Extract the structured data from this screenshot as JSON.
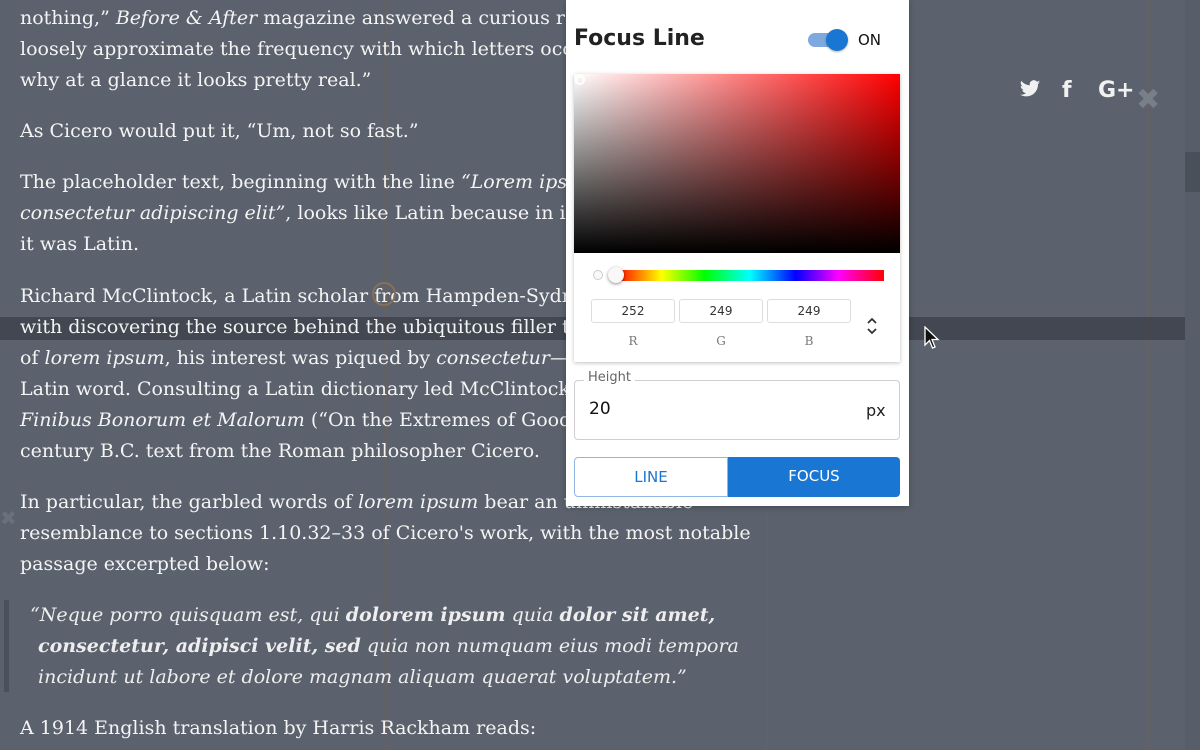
{
  "article": {
    "lines": [
      [
        {
          "t": "nothing,” "
        },
        {
          "t": "Before & After",
          "em": true
        },
        {
          "t": " magazine answered a curious reade"
        }
      ],
      [
        {
          "t": "loosely approximate the frequency with which letters occur i"
        }
      ],
      [
        {
          "t": "why at a glance it looks pretty real.”"
        }
      ],
      [
        {
          "t": "As Cicero would put it, “Um, not so fast.”"
        }
      ],
      [
        {
          "t": "The placeholder text, beginning with the line "
        },
        {
          "t": "“Lorem ipsum",
          "em": true
        }
      ],
      [
        {
          "t": "consectetur adipiscing elit”",
          "em": true
        },
        {
          "t": ", looks like Latin because in its yo"
        }
      ],
      [
        {
          "t": "it was Latin."
        }
      ],
      [
        {
          "t": "Richard McClintock, a Latin scholar from Hampden-Sydney"
        }
      ],
      [
        {
          "t": "with discovering the source behind the ubiquitous filler text."
        }
      ],
      [
        {
          "t": "of "
        },
        {
          "t": "lorem ipsum",
          "em": true
        },
        {
          "t": ", his interest was piqued by "
        },
        {
          "t": "consectetur",
          "em": true
        },
        {
          "t": "—a ge"
        }
      ],
      [
        {
          "t": "Latin word. Consulting a Latin dictionary led McClintock to"
        }
      ],
      [
        {
          "t": "Finibus Bonorum et Malorum",
          "em": true
        },
        {
          "t": " (“On the Extremes of Good an"
        }
      ],
      [
        {
          "t": "century B.C. text from the Roman philosopher Cicero."
        }
      ],
      [
        {
          "t": "In particular, the garbled words of "
        },
        {
          "t": "lorem ipsum",
          "em": true
        },
        {
          "t": " bear an unmistakable"
        }
      ],
      [
        {
          "t": "resemblance to sections 1.10.32–33 of Cicero's work, with the most notable"
        }
      ],
      [
        {
          "t": "passage excerpted below:"
        }
      ],
      [
        {
          "t": "“Neque porro quisquam est, qui ",
          "em": true
        },
        {
          "t": "dolorem ipsum",
          "b": true
        },
        {
          "t": " quia ",
          "em": true
        },
        {
          "t": "dolor sit amet,",
          "b": true
        }
      ],
      [
        {
          "t": "consectetur, adipisci velit, sed",
          "b": true
        },
        {
          "t": " quia non numquam eius modi tempora",
          "em": true
        }
      ],
      [
        {
          "t": "incidunt ut labore et dolore magnam aliquam quaerat voluptatem.”",
          "em": true
        }
      ],
      [
        {
          "t": "A 1914 English translation by Harris Rackham reads:"
        }
      ]
    ]
  },
  "social": {
    "twitter": "🐦",
    "facebook": "f",
    "google": "G+"
  },
  "icons": {
    "close": "✖",
    "left_close": "✖",
    "cursor": "mouse-pointer-icon"
  },
  "panel": {
    "title": "Focus Line",
    "toggle_label": "ON",
    "toggle_on": true,
    "color": {
      "r": "252",
      "g": "249",
      "b": "249",
      "hue_position": 0.01
    },
    "rgb_labels": {
      "r": "R",
      "g": "G",
      "b": "B"
    },
    "arrows": "⌃\n⌄",
    "height": {
      "label": "Height",
      "value": "20",
      "unit": "px"
    },
    "modes": {
      "line": "LINE",
      "focus": "FOCUS",
      "selected": "focus"
    }
  },
  "colors": {
    "accent": "#1976d2",
    "page_bg": "#5b626d",
    "text": "#f4f4f4"
  }
}
